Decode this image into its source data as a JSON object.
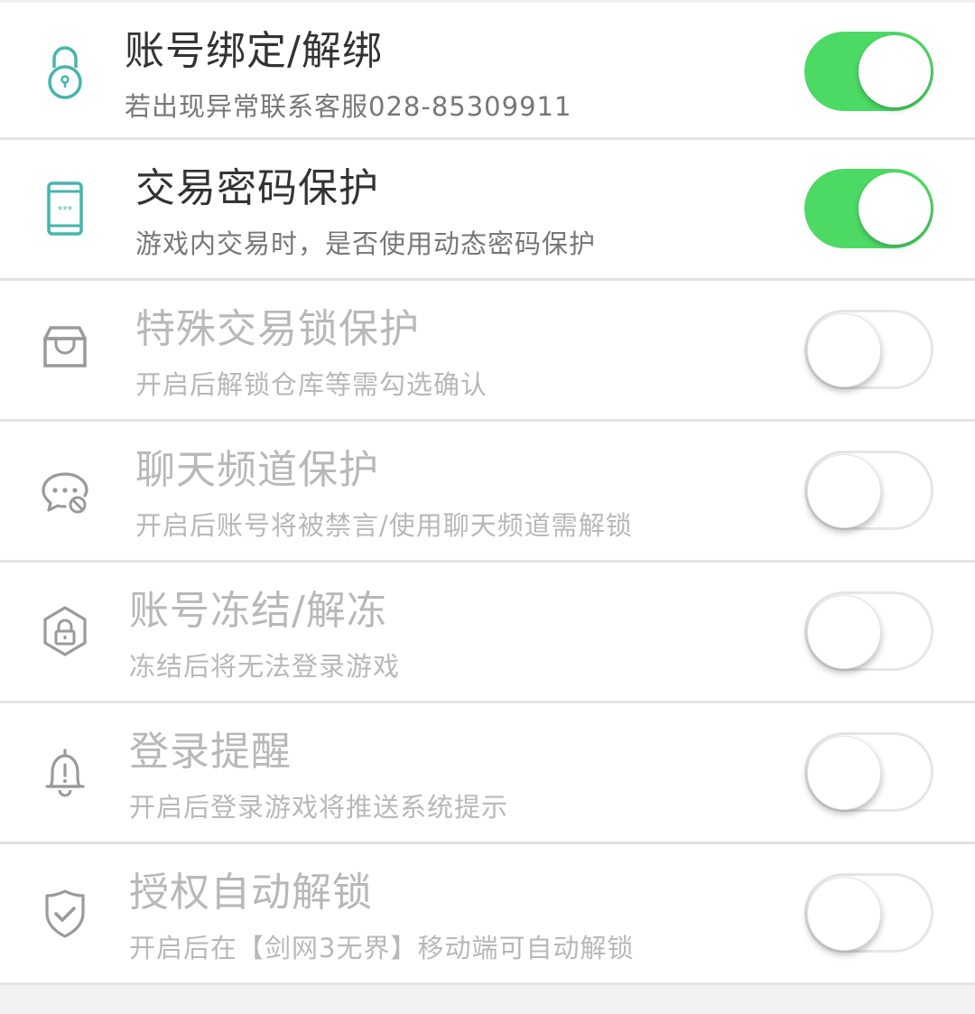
{
  "colors": {
    "accent_icon": "#45b6ac",
    "toggle_on": "#4cd964",
    "disabled_text": "#b8b8b8",
    "title_text": "#333333",
    "subtitle_text": "#777777"
  },
  "settings": [
    {
      "title": "账号绑定/解绑",
      "subtitle": "若出现异常联系客服028-85309911",
      "icon": "padlock-icon",
      "enabled": true
    },
    {
      "title": "交易密码保护",
      "subtitle": "游戏内交易时，是否使用动态密码保护",
      "icon": "phone-password-icon",
      "enabled": true
    },
    {
      "title": "特殊交易锁保护",
      "subtitle": "开启后解锁仓库等需勾选确认",
      "icon": "storage-box-icon",
      "enabled": false
    },
    {
      "title": "聊天频道保护",
      "subtitle": "开启后账号将被禁言/使用聊天频道需解锁",
      "icon": "chat-block-icon",
      "enabled": false
    },
    {
      "title": "账号冻结/解冻",
      "subtitle": "冻结后将无法登录游戏",
      "icon": "frozen-lock-icon",
      "enabled": false
    },
    {
      "title": "登录提醒",
      "subtitle": "开启后登录游戏将推送系统提示",
      "icon": "alert-bell-icon",
      "enabled": false
    },
    {
      "title": "授权自动解锁",
      "subtitle": "开启后在【剑网3无界】移动端可自动解锁",
      "icon": "shield-check-icon",
      "enabled": false
    }
  ]
}
